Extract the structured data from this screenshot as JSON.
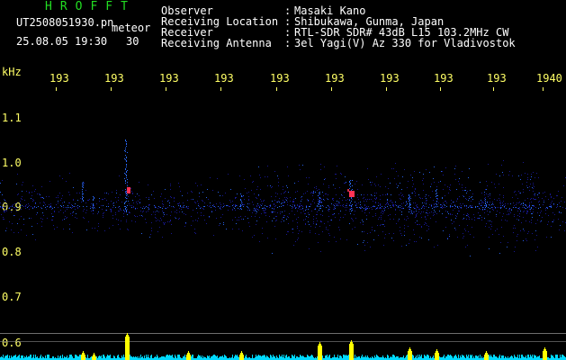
{
  "header": {
    "brand": "HROFFT",
    "filename": "UT2508051930.pn",
    "meteor_label": "meteor",
    "datetime": "25.08.05 19:30",
    "duration": "30",
    "fields": [
      {
        "label": "Observer",
        "sep": ":",
        "value": "Masaki Kano"
      },
      {
        "label": "Receiving Location",
        "sep": ":",
        "value": "Shibukawa, Gunma, Japan"
      },
      {
        "label": "Receiver",
        "sep": ":",
        "value": "RTL-SDR SDR# 43dB L15 103.2MHz CW"
      },
      {
        "label": "Receiving Antenna",
        "sep": ":",
        "value": "3el Yagi(V) Az 330 for Vladivostok"
      }
    ]
  },
  "axis": {
    "unit": "kHz",
    "y_ticks": [
      "1.1",
      "1.0",
      "0.9",
      "0.8",
      "0.7",
      "0.6"
    ],
    "x_ticks": [
      "193",
      "193",
      "193",
      "193",
      "193",
      "193",
      "193",
      "193",
      "193",
      "1940"
    ]
  },
  "colors": {
    "label": "#ffffff",
    "accent": "#ffff66",
    "brand": "#22dd22",
    "signal_low": "#1a1aa0",
    "signal_mid": "#2a6aff",
    "signal_high": "#ff3355",
    "meter": "#00d8ff",
    "meter_peak": "#ffff00"
  }
}
